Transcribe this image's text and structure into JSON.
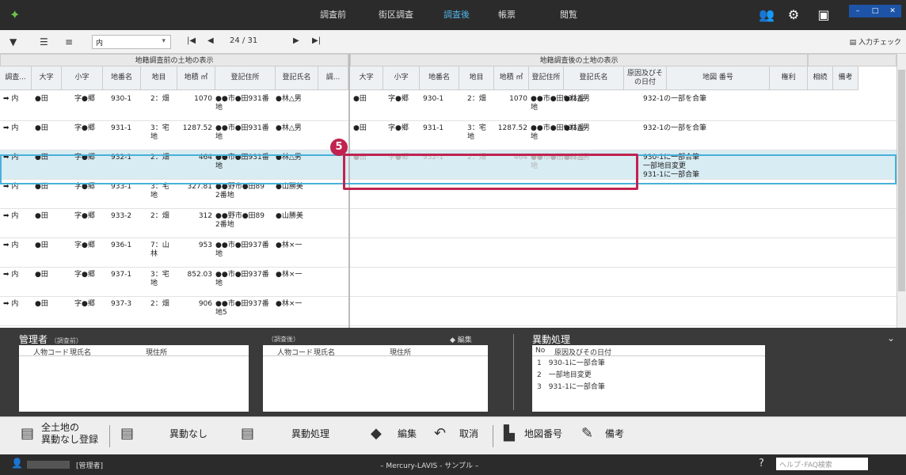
{
  "nav": {
    "items": [
      "調査前",
      "街区調査",
      "調査後",
      "帳票",
      "閲覧"
    ],
    "active": "調査後"
  },
  "toolbar": {
    "select_value": "内",
    "page": "24 / 31",
    "input_check": "入力チェック"
  },
  "left_header": "地籍調査前の土地の表示",
  "right_header": "地籍調査後の土地の表示",
  "left_cols": [
    "調査...",
    "大字",
    "小字",
    "地番名",
    "地目",
    "地積\n㎡",
    "登記住所",
    "登記氏名",
    "調..."
  ],
  "right_cols": [
    "大字",
    "小字",
    "地番名",
    "地目",
    "地積\n㎡",
    "登記住所",
    "登記氏名",
    "原因及びその日付",
    "地図\n番号",
    "権利",
    "相続",
    "備考"
  ],
  "rows": [
    {
      "l": [
        "➡ 内",
        "●田",
        "字●郷",
        "930-1",
        "2：畑",
        "1070",
        "●●市●田931番\n地",
        "●林△男"
      ],
      "r": [
        "●田",
        "字●郷",
        "930-1",
        "2：畑",
        "1070",
        "●●市●田931番\n地",
        "●林△男",
        "932-1の一部を合筆"
      ]
    },
    {
      "l": [
        "➡ 内",
        "●田",
        "字●郷",
        "931-1",
        "3：宅\n地",
        "1287.52",
        "●●市●田931番\n地",
        "●林△男"
      ],
      "r": [
        "●田",
        "字●郷",
        "931-1",
        "3：宅\n地",
        "1287.52",
        "●●市●田931番\n地",
        "●林△男",
        "932-1の一部を合筆"
      ]
    },
    {
      "l": [
        "➡ 内",
        "●田",
        "字●郷",
        "932-1",
        "2：畑",
        "464",
        "●●市●田931番\n地",
        "●林△男"
      ],
      "r": [
        "●田",
        "字●郷",
        "932-1",
        "2：畑",
        "464",
        "●●市●田931番\n地",
        "●林△男",
        "930-1に一部合筆\n一部地目変更\n931-1に一部合筆"
      ]
    },
    {
      "l": [
        "➡ 内",
        "●田",
        "字●郷",
        "933-1",
        "3：宅\n地",
        "327.81",
        "●●野市●田89\n2番地",
        "●山勝美"
      ],
      "r": []
    },
    {
      "l": [
        "➡ 内",
        "●田",
        "字●郷",
        "933-2",
        "2：畑",
        "312",
        "●●野市●田89\n2番地",
        "●山勝美"
      ],
      "r": []
    },
    {
      "l": [
        "➡ 内",
        "●田",
        "字●郷",
        "936-1",
        "7：山\n林",
        "953",
        "●●市●田937番\n地",
        "●林×一"
      ],
      "r": []
    },
    {
      "l": [
        "➡ 内",
        "●田",
        "字●郷",
        "937-1",
        "3：宅\n地",
        "852.03",
        "●●市●田937番\n地",
        "●林×一"
      ],
      "r": []
    },
    {
      "l": [
        "➡ 内",
        "●田",
        "字●郷",
        "937-3",
        "2：畑",
        "906",
        "●●市●田937番\n地5",
        "●林×一"
      ],
      "r": []
    }
  ],
  "badge": "5",
  "panel": {
    "manager_title": "管理者",
    "manager_sub": "（調査前）",
    "after_sub": "（調査後）",
    "col_code": "人物コード",
    "col_name": "現氏名",
    "col_addr": "現住所",
    "edit": "編集",
    "history_title": "異動処理",
    "history_cols": [
      "No",
      "原因及びその日付"
    ],
    "history": [
      "1　930-1に一部合筆",
      "2　一部地目変更",
      "3　931-1に一部合筆"
    ]
  },
  "buttons": {
    "all": "全土地の\n異動なし登録",
    "none": "異動なし",
    "proc": "異動処理",
    "edit": "編集",
    "cancel": "取消",
    "map": "地図番号",
    "note": "備考"
  },
  "status": {
    "user": "[管理者]",
    "app": "– Mercury-LAVIS - サンプル –",
    "help": "ヘルプ･FAQ検索"
  }
}
